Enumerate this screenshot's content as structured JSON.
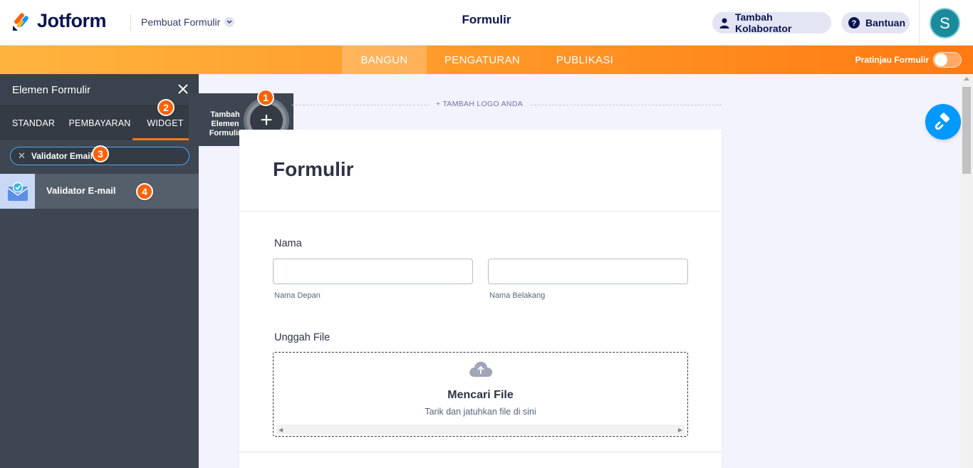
{
  "header": {
    "brand": "Jotform",
    "builder_menu": "Pembuat Formulir",
    "form_title": "Formulir",
    "collaborator_button": "Tambah Kolaborator",
    "help_button": "Bantuan",
    "avatar_initial": "S"
  },
  "nav": {
    "tabs": [
      {
        "label": "BANGUN",
        "active": true
      },
      {
        "label": "PENGATURAN",
        "active": false
      },
      {
        "label": "PUBLIKASI",
        "active": false
      }
    ],
    "preview_label": "Pratinjau Formulir",
    "preview_on": false
  },
  "panel": {
    "title": "Elemen Formulir",
    "tabs": [
      {
        "label": "STANDAR",
        "active": false
      },
      {
        "label": "PEMBAYARAN",
        "active": false
      },
      {
        "label": "WIDGET",
        "active": true
      }
    ],
    "search_value": "Validator Email",
    "result_label": "Validator E-mail"
  },
  "add_element": {
    "label": "Tambah Elemen Formulir"
  },
  "badges": [
    "1",
    "2",
    "3",
    "4"
  ],
  "form": {
    "add_logo": "+ TAMBAH LOGO ANDA",
    "heading": "Formulir",
    "name_label": "Nama",
    "first_name_sub": "Nama Depan",
    "last_name_sub": "Nama Belakang",
    "upload_label": "Unggah File",
    "upload_title": "Mencari File",
    "upload_sub": "Tarik dan jatuhkan file di sini"
  },
  "colors": {
    "accent_orange": "#ff7a12",
    "badge_orange": "#ff6100",
    "panel_dark": "#3e4652",
    "paint_blue": "#0099ff"
  }
}
